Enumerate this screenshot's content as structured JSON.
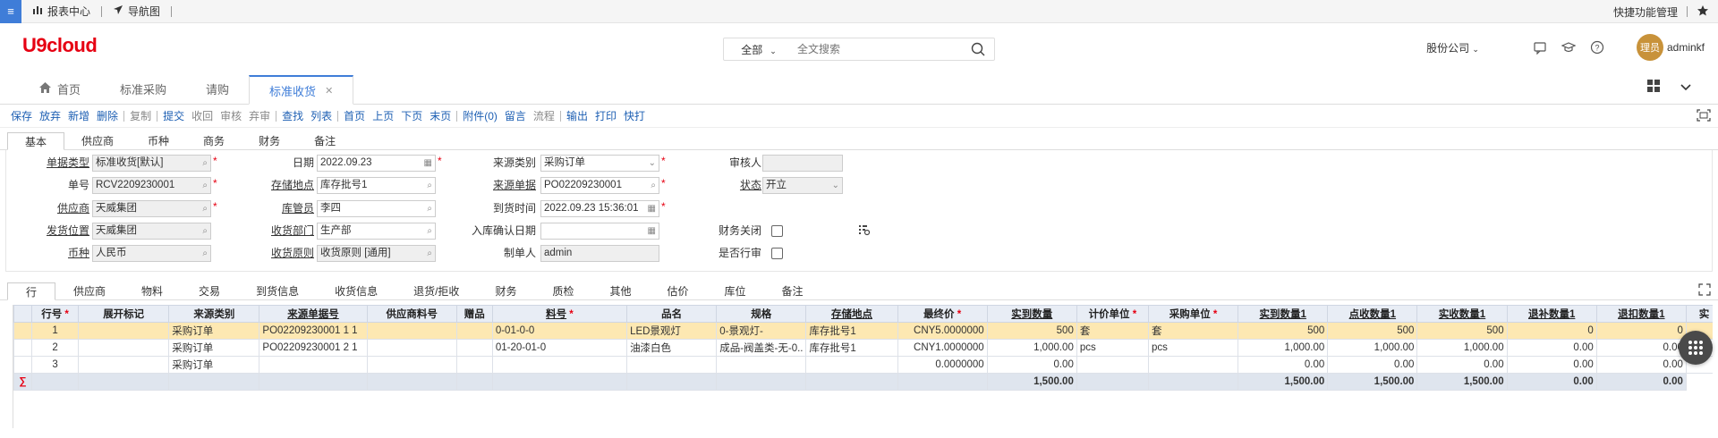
{
  "topbar": {
    "menu_glyph": "≡",
    "report_center": "报表中心",
    "nav_map": "导航图",
    "quick_manage": "快捷功能管理"
  },
  "header": {
    "logo": "U9cloud",
    "search_scope": "全部",
    "search_placeholder": "全文搜索",
    "company": "股份公司",
    "avatar_text": "理员",
    "username": "adminkf"
  },
  "tabs": [
    {
      "label": "首页"
    },
    {
      "label": "标准采购"
    },
    {
      "label": "请购"
    },
    {
      "label": "标准收货"
    }
  ],
  "toolbar": [
    "保存",
    "放弃",
    "新增",
    "删除",
    "复制",
    "提交",
    "收回",
    "审核",
    "弃审",
    "查找",
    "列表",
    "首页",
    "上页",
    "下页",
    "末页",
    "附件(0)",
    "留言",
    "流程",
    "输出",
    "打印",
    "快打"
  ],
  "form_tabs": [
    "基本",
    "供应商",
    "币种",
    "商务",
    "财务",
    "备注"
  ],
  "form": {
    "doc_type_label": "单据类型",
    "doc_type": "标准收货[默认]",
    "doc_no_label": "单号",
    "doc_no": "RCV2209230001",
    "supplier_label": "供应商",
    "supplier": "天威集团",
    "ship_loc_label": "发货位置",
    "ship_loc": "天威集团",
    "currency_label": "币种",
    "currency": "人民币",
    "date_label": "日期",
    "date": "2022.09.23",
    "store_loc_label": "存储地点",
    "store_loc": "库存批号1",
    "keeper_label": "库管员",
    "keeper": "李四",
    "recv_dept_label": "收货部门",
    "recv_dept": "生产部",
    "recv_rule_label": "收货原则",
    "recv_rule": "收货原则 [通用]",
    "src_type_label": "来源类别",
    "src_type": "采购订单",
    "src_doc_label": "来源单据",
    "src_doc": "PO02209230001",
    "arrive_label": "到货时间",
    "arrive": "2022.09.23 15:36:01",
    "in_confirm_label": "入库确认日期",
    "in_confirm": "",
    "maker_label": "制单人",
    "maker": "admin",
    "reviewer_label": "审核人",
    "reviewer": "",
    "status_label": "状态",
    "status": "开立",
    "fin_close_label": "财务关闭",
    "is_line_review_label": "是否行审"
  },
  "line_tabs": [
    "行",
    "供应商",
    "物料",
    "交易",
    "到货信息",
    "收货信息",
    "退货/拒收",
    "财务",
    "质检",
    "其他",
    "估价",
    "库位",
    "备注"
  ],
  "grid": {
    "columns": [
      "行号",
      "展开标记",
      "来源类别",
      "来源单据号",
      "供应商料号",
      "赠品",
      "料号",
      "品名",
      "规格",
      "存储地点",
      "最终价",
      "实到数量",
      "计价单位",
      "采购单位",
      "实到数量1",
      "点收数量1",
      "实收数量1",
      "退补数量1",
      "退扣数量1",
      "实"
    ],
    "required": [
      "行号",
      "料号",
      "最终价",
      "计价单位",
      "采购单位"
    ],
    "underlined": [
      "来源单据号",
      "料号",
      "存储地点",
      "实到数量",
      "实到数量1",
      "点收数量1",
      "实收数量1",
      "退补数量1",
      "退扣数量1"
    ],
    "rows": [
      [
        "1",
        "",
        "采购订单",
        "PO02209230001 1 1",
        "",
        "",
        "0-01-0-0",
        "LED景观灯",
        "0-景观灯-",
        "库存批号1",
        "CNY5.0000000",
        "500",
        "套",
        "套",
        "500",
        "500",
        "500",
        "0",
        "0",
        ""
      ],
      [
        "2",
        "",
        "采购订单",
        "PO02209230001 2 1",
        "",
        "",
        "01-20-01-0",
        "油漆白色",
        "成品-阀盖类-无-0..",
        "库存批号1",
        "CNY1.0000000",
        "1,000.00",
        "pcs",
        "pcs",
        "1,000.00",
        "1,000.00",
        "1,000.00",
        "0.00",
        "0.00",
        ""
      ],
      [
        "3",
        "",
        "采购订单",
        "",
        "",
        "",
        "",
        "",
        "",
        "",
        "0.0000000",
        "0.00",
        "",
        "",
        "0.00",
        "0.00",
        "0.00",
        "0.00",
        "0.00",
        ""
      ]
    ],
    "sum_row": [
      "∑",
      "",
      "",
      "",
      "",
      "",
      "",
      "",
      "",
      "",
      "",
      "1,500.00",
      "",
      "",
      "1,500.00",
      "1,500.00",
      "1,500.00",
      "0.00",
      "0.00",
      "0"
    ]
  },
  "colors": {
    "accent": "#3f7dd8",
    "brand": "#e60012",
    "selected_row": "#fde8b2"
  }
}
